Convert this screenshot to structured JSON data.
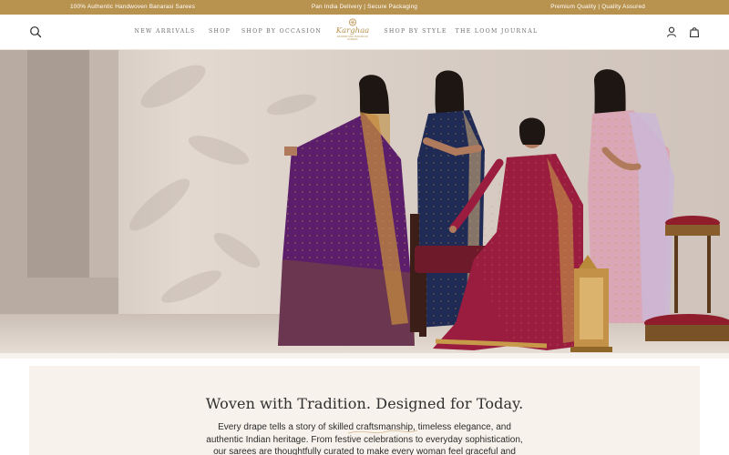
{
  "announcement": {
    "left": "100% Authentic Handwoven Banarasi Sarees",
    "center": "Pan India Delivery | Secure Packaging",
    "right": "Premium Quality | Quality Assured"
  },
  "header": {
    "icons": [
      "search-icon",
      "user-icon",
      "shopping-bag-icon"
    ],
    "nav_left": [
      "NEW ARRIVALS",
      "SHOP",
      "SHOP BY OCCASION"
    ],
    "nav_right": [
      "SHOP BY STYLE",
      "THE LOOM JOURNAL"
    ],
    "logo": {
      "word": "Karghaa",
      "tagline": "HANDWOVEN BANARASI SAREES"
    }
  },
  "hero": {
    "image": "four women in handwoven Banarasi sarees",
    "colors": {
      "purple_saree": "#5a1e6b",
      "navy_saree": "#1f2a55",
      "red_saree": "#9a1d3f",
      "pink_saree": "#d9a7b5"
    }
  },
  "intro": {
    "title": "Woven with Tradition. Designed for Today.",
    "body": "Every drape tells a story of skilled craftsmanship, timeless elegance, and authentic Indian heritage. From festive celebrations to everyday sophistication, our sarees are thoughtfully curated to make every woman feel graceful and confident."
  },
  "theme": {
    "accent": "#b89350",
    "cream": "#f7f2eb"
  }
}
